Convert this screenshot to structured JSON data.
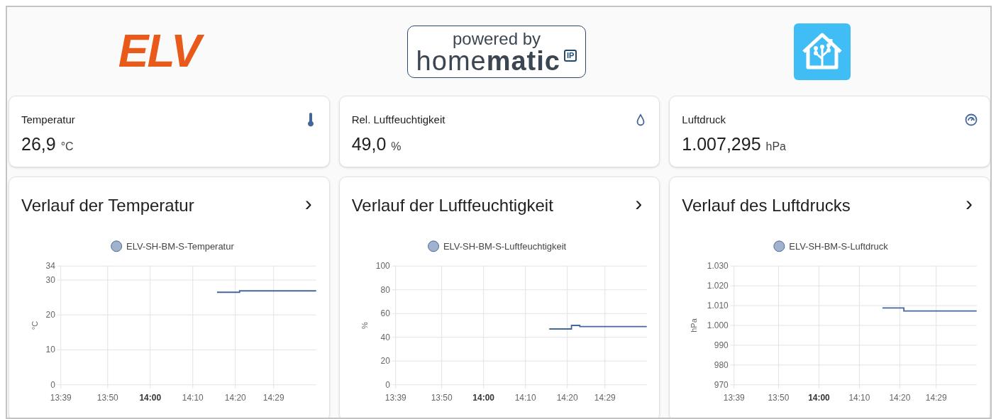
{
  "logos": [
    {
      "kind": "elv",
      "text": "ELV"
    },
    {
      "kind": "homematic",
      "tagline": "powered by",
      "light": "home",
      "bold": "matic",
      "badge": "IP"
    },
    {
      "kind": "home_assistant"
    }
  ],
  "sensors": [
    {
      "name": "Temperatur",
      "value": "26,9",
      "unit": "°C",
      "kind": "thermometer"
    },
    {
      "name": "Rel. Luftfeuchtigkeit",
      "value": "49,0",
      "unit": "%",
      "kind": "drop"
    },
    {
      "name": "Luftdruck",
      "value": "1.007,295",
      "unit": "hPa",
      "kind": "gauge"
    }
  ],
  "history_cards": [
    {
      "title": "Verlauf der Temperatur",
      "chevron": "›",
      "chart_data": {
        "type": "line",
        "ylabel": "°C",
        "grid": true,
        "xlim": [
          819,
          879
        ],
        "ylim": [
          0,
          34
        ],
        "xticks": [
          {
            "value": 819,
            "label": "13:39"
          },
          {
            "value": 830,
            "label": "13:50"
          },
          {
            "value": 840,
            "label": "**14:00**"
          },
          {
            "value": 850,
            "label": "14:10"
          },
          {
            "value": 860,
            "label": "14:20"
          },
          {
            "value": 869,
            "label": "14:29"
          }
        ],
        "yticks": [
          0,
          10,
          20,
          30,
          34
        ],
        "x": [
          855.7,
          861,
          861,
          879
        ],
        "series": [
          {
            "name": "ELV-SH-BM-S-Temperatur",
            "color": "#44679a",
            "values": [
              26.5,
              26.5,
              26.9,
              26.9
            ]
          }
        ]
      }
    },
    {
      "title": "Verlauf der Luftfeuchtigkeit",
      "chevron": "›",
      "chart_data": {
        "type": "line",
        "ylabel": "%",
        "grid": true,
        "xlim": [
          819,
          879
        ],
        "ylim": [
          0,
          100
        ],
        "xticks": [
          {
            "value": 819,
            "label": "13:39"
          },
          {
            "value": 830,
            "label": "13:50"
          },
          {
            "value": 840,
            "label": "**14:00**"
          },
          {
            "value": 850,
            "label": "14:10"
          },
          {
            "value": 860,
            "label": "14:20"
          },
          {
            "value": 869,
            "label": "14:29"
          }
        ],
        "yticks": [
          0,
          20,
          40,
          60,
          80,
          100
        ],
        "x": [
          855.7,
          861,
          861,
          863,
          863,
          879
        ],
        "series": [
          {
            "name": "ELV-SH-BM-S-Luftfeuchtigkeit",
            "color": "#44679a",
            "values": [
              47,
              47,
              50,
              50,
              49,
              49
            ]
          }
        ]
      }
    },
    {
      "title": "Verlauf des Luftdrucks",
      "chevron": "›",
      "chart_data": {
        "type": "line",
        "ylabel": "hPa",
        "grid": true,
        "xlim": [
          819,
          879
        ],
        "ylim": [
          970,
          1030
        ],
        "xticks": [
          {
            "value": 819,
            "label": "13:39"
          },
          {
            "value": 830,
            "label": "13:50"
          },
          {
            "value": 840,
            "label": "**14:00**"
          },
          {
            "value": 850,
            "label": "14:10"
          },
          {
            "value": 860,
            "label": "14:20"
          },
          {
            "value": 869,
            "label": "14:29"
          }
        ],
        "yticks": [
          {
            "value": 970,
            "label": "970"
          },
          {
            "value": 980,
            "label": "980"
          },
          {
            "value": 990,
            "label": "990"
          },
          {
            "value": 1000,
            "label": "1.000"
          },
          {
            "value": 1010,
            "label": "1.010"
          },
          {
            "value": 1020,
            "label": "1.020"
          },
          {
            "value": 1030,
            "label": "1.030"
          }
        ],
        "x": [
          855.7,
          861,
          861,
          879
        ],
        "series": [
          {
            "name": "ELV-SH-BM-S-Luftdruck",
            "color": "#44679a",
            "values": [
              1008.8,
              1008.8,
              1007.3,
              1007.3
            ]
          }
        ]
      }
    }
  ]
}
